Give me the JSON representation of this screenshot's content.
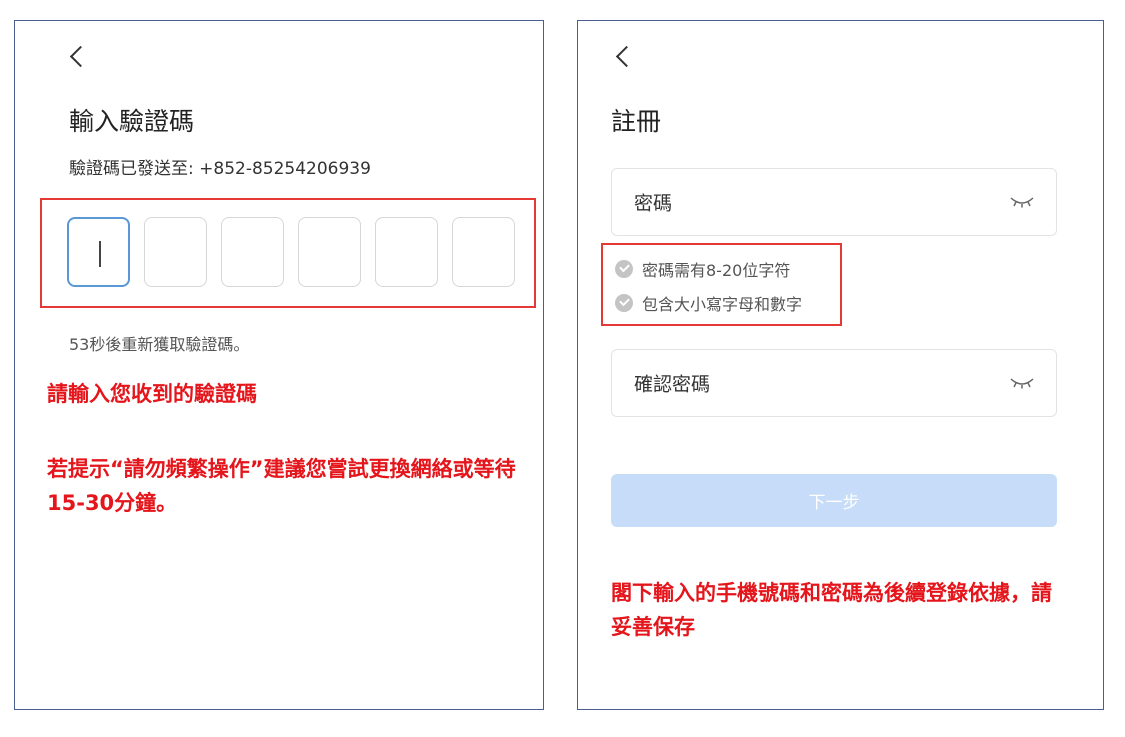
{
  "verify_screen": {
    "title": "輸入驗證碼",
    "sent_to_label": "驗證碼已發送至: +852-85254206939",
    "code_cells": [
      "",
      "",
      "",
      "",
      "",
      ""
    ],
    "resend_countdown": "53秒後重新獲取驗證碼。",
    "note_enter_code": "請輸入您收到的驗證碼",
    "note_frequent_operation": "若提示“請勿頻繁操作”建議您嘗試更換網絡或等待15-30分鐘。"
  },
  "register_screen": {
    "title": "註冊",
    "password_placeholder": "密碼",
    "password_rules": [
      "密碼需有8-20位字符",
      "包含大小寫字母和數字"
    ],
    "confirm_password_placeholder": "確認密碼",
    "next_button_label": "下一步",
    "note_save_credentials": "閣下輸入的手機號碼和密碼為後續登錄依據，請妥善保存"
  },
  "icons": {
    "back": "chevron-left-icon",
    "password_visibility": "eye-closed-icon",
    "rule_status": "check-circle-icon"
  },
  "colors": {
    "highlight_red": "#e53935",
    "note_red": "#e4151b",
    "active_cell_border": "#5a97d6",
    "next_button_disabled": "#c6dcf8",
    "panel_border": "#4a5f8f"
  }
}
